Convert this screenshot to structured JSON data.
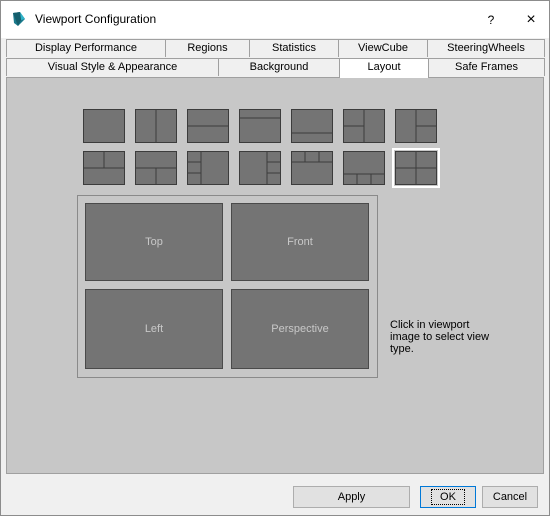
{
  "window": {
    "title": "Viewport Configuration",
    "help_label": "?",
    "close_label": "×",
    "icon": "3dsmax-app-icon"
  },
  "tabs_row_back": [
    {
      "label": "Display Performance"
    },
    {
      "label": "Regions"
    },
    {
      "label": "Statistics"
    },
    {
      "label": "ViewCube"
    },
    {
      "label": "SteeringWheels"
    }
  ],
  "tabs_row_front": [
    {
      "label": "Visual Style & Appearance"
    },
    {
      "label": "Background"
    },
    {
      "label": "Layout",
      "active": true
    },
    {
      "label": "Safe Frames"
    }
  ],
  "layout": {
    "presets_count_row1": 7,
    "presets_count_row2": 7,
    "selected_preset": "row2-7",
    "preview_viewports": {
      "top_left": "Top",
      "top_right": "Front",
      "bottom_left": "Left",
      "bottom_right": "Perspective"
    },
    "hint": "Click in viewport image to select view type."
  },
  "footer": {
    "apply_label": "Apply",
    "ok_label": "OK",
    "cancel_label": "Cancel"
  },
  "colors": {
    "viewport_fill": "#747474",
    "panel_bg": "#c7c7c7",
    "accent": "#0078d7"
  }
}
